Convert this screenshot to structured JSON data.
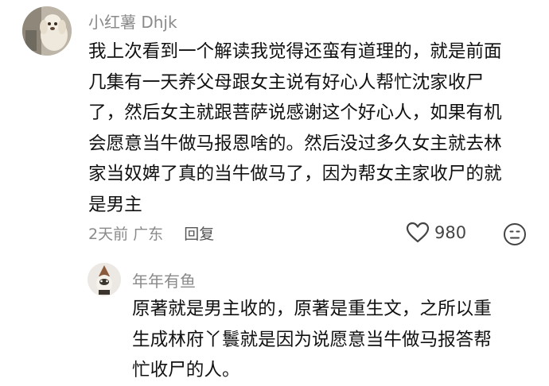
{
  "comment": {
    "username": "小红薯 Dhjk",
    "avatar_icon": "poodle-dog-avatar",
    "text_lines": [
      "我上次看到一个解读我觉得还蛮有道理的，就是前面",
      "几集有一天养父母跟女主说有好心人帮忙沈家收尸",
      "了，然后女主就跟菩萨说感谢这个好心人，如果有机",
      "会愿意当牛做马报恩啥的。然后没过多久女主就去林",
      "家当奴婢了真的当牛做马了，因为帮女主家收尸的就",
      "是男主"
    ],
    "time": "2天前",
    "location": "广东",
    "reply_label": "回复",
    "like_icon": "heart-outline-icon",
    "like_count": "980",
    "emoji_icon": "smiley-face-icon"
  },
  "reply": {
    "username": "年年有鱼",
    "avatar_icon": "cat-avatar",
    "text_lines": [
      "原著就是男主收的，原著是重生文，之所以重",
      "生成林府丫鬟就是因为说愿意当牛做马报答帮",
      "忙收尸的人。"
    ]
  }
}
